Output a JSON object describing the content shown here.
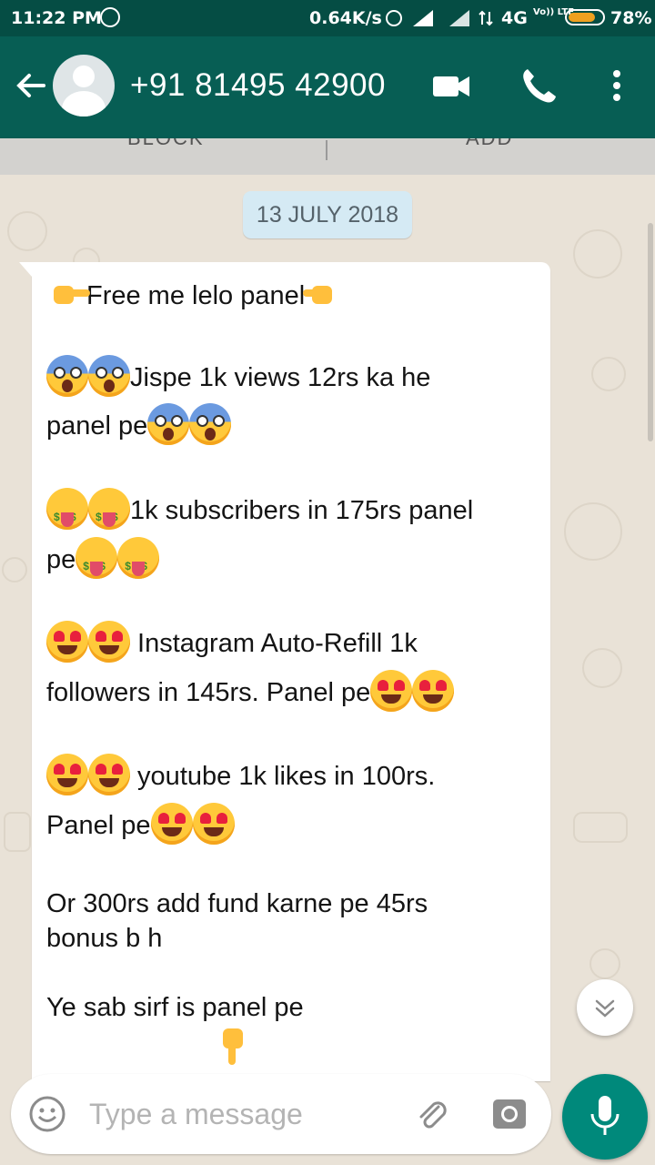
{
  "status_bar": {
    "time": "11:22 PM",
    "speed": "0.64K/s",
    "network": "4G",
    "volte": "Vo)) LTE",
    "battery_pct": "78%",
    "battery_level": 0.78
  },
  "header": {
    "contact": "+91 81495 42900"
  },
  "action_bar": {
    "block_label": "BLOCK",
    "add_label": "ADD"
  },
  "chat": {
    "date_chip": "13 JULY 2018",
    "message": {
      "line1": "Free me lelo panel",
      "line2a": "Jispe 1k views 12rs ka  he",
      "line2b": "panel pe",
      "line3a": "1k subscribers in 175rs panel",
      "line3b": "pe",
      "line4a": " Instagram Auto-Refill 1k",
      "line4b": "followers in 145rs. Panel pe",
      "line5a": " youtube 1k likes in 100rs.",
      "line5b": "Panel pe",
      "line6a": "Or 300rs add fund karne pe 45rs",
      "line6b": "bonus b h",
      "line7": "Ye sab sirf is  panel pe"
    }
  },
  "composer": {
    "placeholder": "Type a message"
  },
  "colors": {
    "appbar": "#075e54",
    "statusbar": "#054d44",
    "mic_button": "#00897b",
    "wallpaper": "#e9e2d7",
    "date_chip": "#d5eaf4"
  }
}
